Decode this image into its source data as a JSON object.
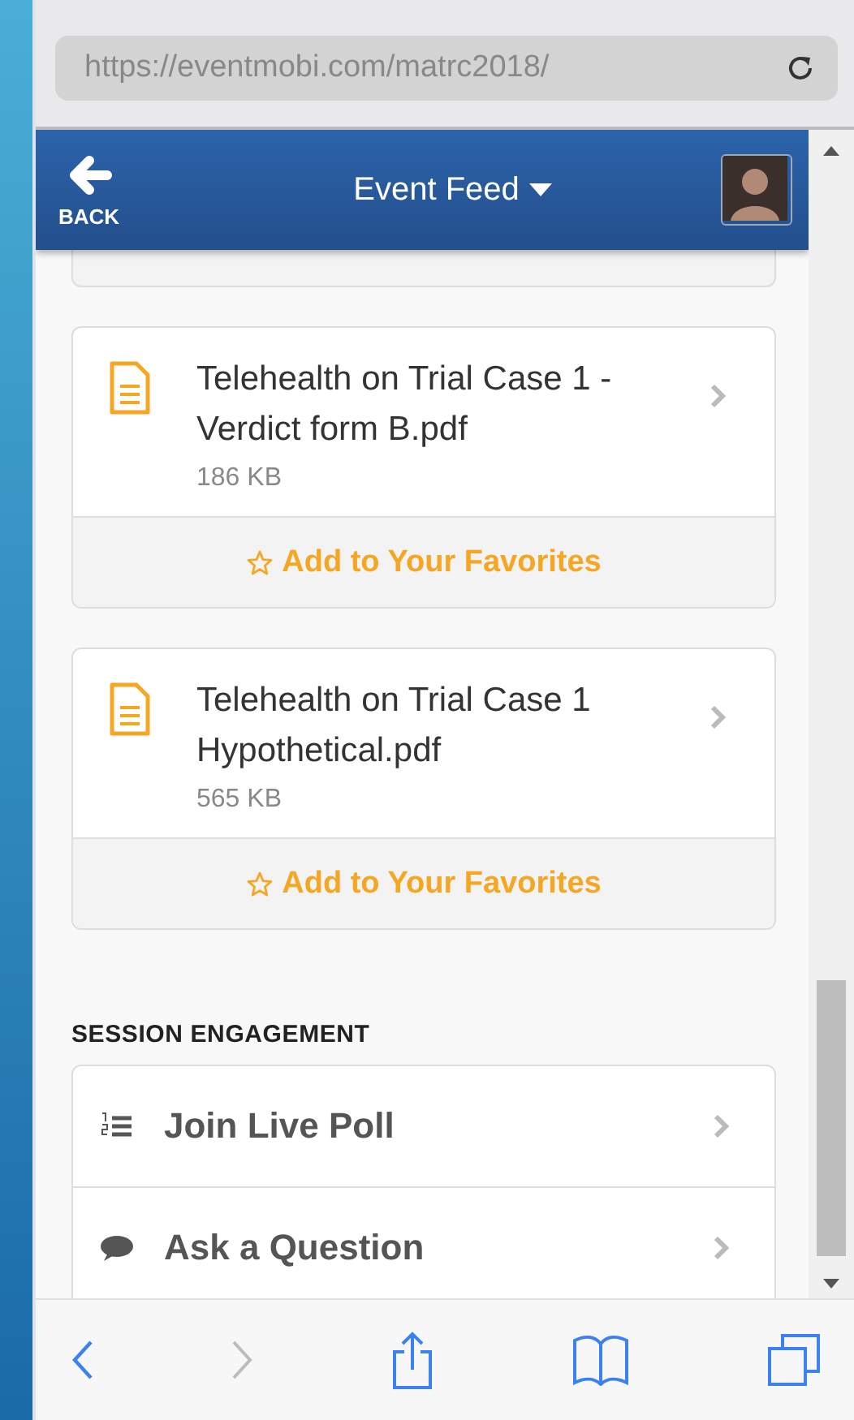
{
  "browser": {
    "url": "https://eventmobi.com/matrc2018/"
  },
  "header": {
    "back_label": "BACK",
    "title": "Event Feed"
  },
  "documents": [
    {
      "name": "Telehealth on Trial Case 1 - Verdict form B.pdf",
      "size": "186 KB",
      "favorite_label": "Add to Your Favorites"
    },
    {
      "name": "Telehealth on Trial Case 1 Hypothetical.pdf",
      "size": "565 KB",
      "favorite_label": "Add to Your Favorites"
    }
  ],
  "session_engagement": {
    "title": "SESSION ENGAGEMENT",
    "items": [
      {
        "kind": "poll",
        "label": "Join Live Poll"
      },
      {
        "kind": "question",
        "label": "Ask a Question"
      }
    ]
  }
}
